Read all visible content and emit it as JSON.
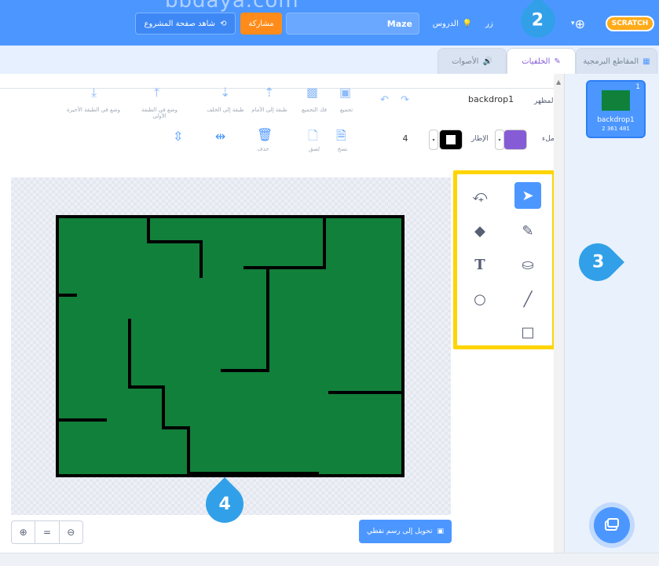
{
  "watermark": "bbdaya.com",
  "topbar": {
    "view_project_page": "شاهد صفحة المشروع",
    "share": "مشاركة",
    "project_title": "Maze",
    "tutorials": "الدروس",
    "partial_label": "زر",
    "logo": "SCRATCH"
  },
  "tabs": {
    "code": "المقاطع البرمجية",
    "backdrops": "الخلفيات",
    "sounds": "الأصوات"
  },
  "toolbar": {
    "backdrop_label": "المظهر",
    "backdrop_name": "backdrop1",
    "group": "تجميع",
    "ungroup": "فك التجميع",
    "forward": "طبقة إلى الأمام",
    "backward": "طبقة إلى الخلف",
    "front": "وضع في الطبقة الأولى",
    "back": "وضع في الطبقة الأخيرة",
    "fill_label": "ملء",
    "outline_label": "الإطار",
    "outline_width": "4",
    "copy": "نسخ",
    "paste": "لصق",
    "delete": "حذف"
  },
  "sprite_panel": {
    "index": "1",
    "name": "backdrop1",
    "size": "2 361 481"
  },
  "editor": {
    "convert_button": "تحويل إلى رسم نقطي"
  },
  "callouts": {
    "c2": "2",
    "c3": "3",
    "c4": "4"
  },
  "colors": {
    "accent": "#4c97ff",
    "highlight": "#ffd400",
    "maze_fill": "#11803a",
    "fill": "#855cd6"
  }
}
